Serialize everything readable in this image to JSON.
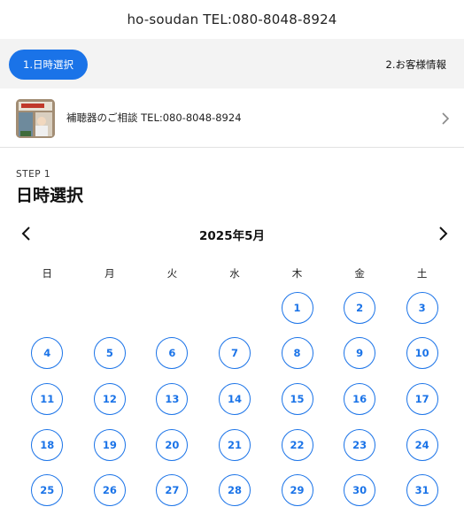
{
  "header": {
    "title": "ho-soudan TEL:080-8048-8924"
  },
  "steps": [
    {
      "label": "1.日時選択",
      "active": true
    },
    {
      "label": "2.お客様情報",
      "active": false
    }
  ],
  "service": {
    "name": "補聴器のご相談 TEL:080-8048-8924",
    "image_icon": "shop-photo-icon",
    "chevron_icon": "chevron-right-icon"
  },
  "step": {
    "label": "STEP 1",
    "title": "日時選択"
  },
  "calendar": {
    "month_label": "2025年5月",
    "prev_icon": "chevron-left-icon",
    "next_icon": "chevron-right-icon",
    "weekdays": [
      "日",
      "月",
      "火",
      "水",
      "木",
      "金",
      "土"
    ],
    "weeks": [
      [
        "",
        "",
        "",
        "",
        "1",
        "2",
        "3"
      ],
      [
        "4",
        "5",
        "6",
        "7",
        "8",
        "9",
        "10"
      ],
      [
        "11",
        "12",
        "13",
        "14",
        "15",
        "16",
        "17"
      ],
      [
        "18",
        "19",
        "20",
        "21",
        "22",
        "23",
        "24"
      ],
      [
        "25",
        "26",
        "27",
        "28",
        "29",
        "30",
        "31"
      ]
    ]
  },
  "colors": {
    "accent": "#1a73e8",
    "steps_bg": "#f3f3f3"
  }
}
